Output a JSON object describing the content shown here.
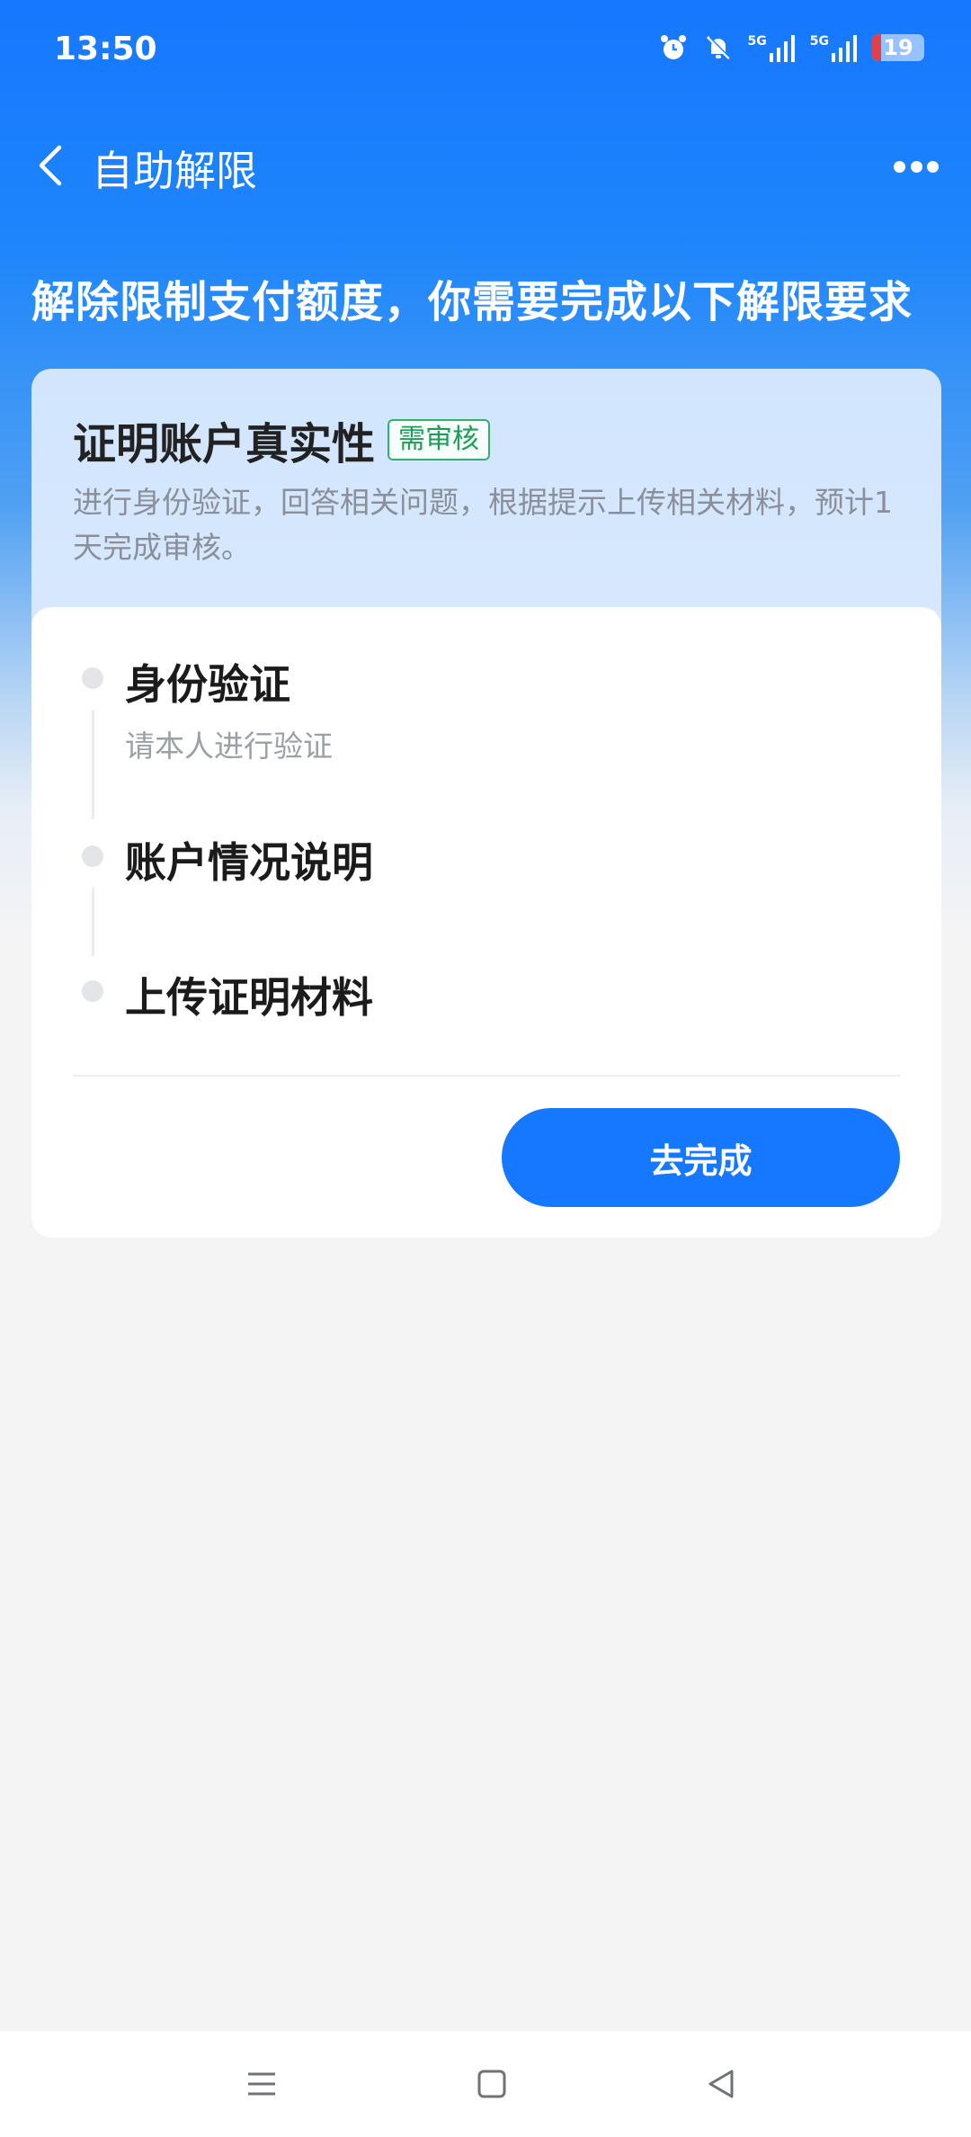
{
  "status_bar": {
    "time": "13:50",
    "network_1": "5G",
    "network_2": "5G",
    "battery": "19",
    "icons": [
      "alarm-icon",
      "mute-icon",
      "signal-icon",
      "signal-icon",
      "battery-icon"
    ]
  },
  "nav": {
    "title": "自助解限",
    "back_icon": "chevron-left-icon",
    "more_icon": "more-dots-icon"
  },
  "headline": "解除限制支付额度，你需要完成以下解限要求",
  "card": {
    "title": "证明账户真实性",
    "badge": "需审核",
    "description": "进行身份验证，回答相关问题，根据提示上传相关材料，预计1天完成审核。",
    "steps": [
      {
        "title": "身份验证",
        "subtitle": "请本人进行验证"
      },
      {
        "title": "账户情况说明",
        "subtitle": ""
      },
      {
        "title": "上传证明材料",
        "subtitle": ""
      }
    ],
    "cta_label": "去完成"
  },
  "colors": {
    "primary": "#1677ff",
    "badge_green": "#1d9c59",
    "background": "#f4f4f5"
  },
  "system_nav": {
    "icons": [
      "menu-icon",
      "home-icon",
      "back-triangle-icon"
    ]
  }
}
